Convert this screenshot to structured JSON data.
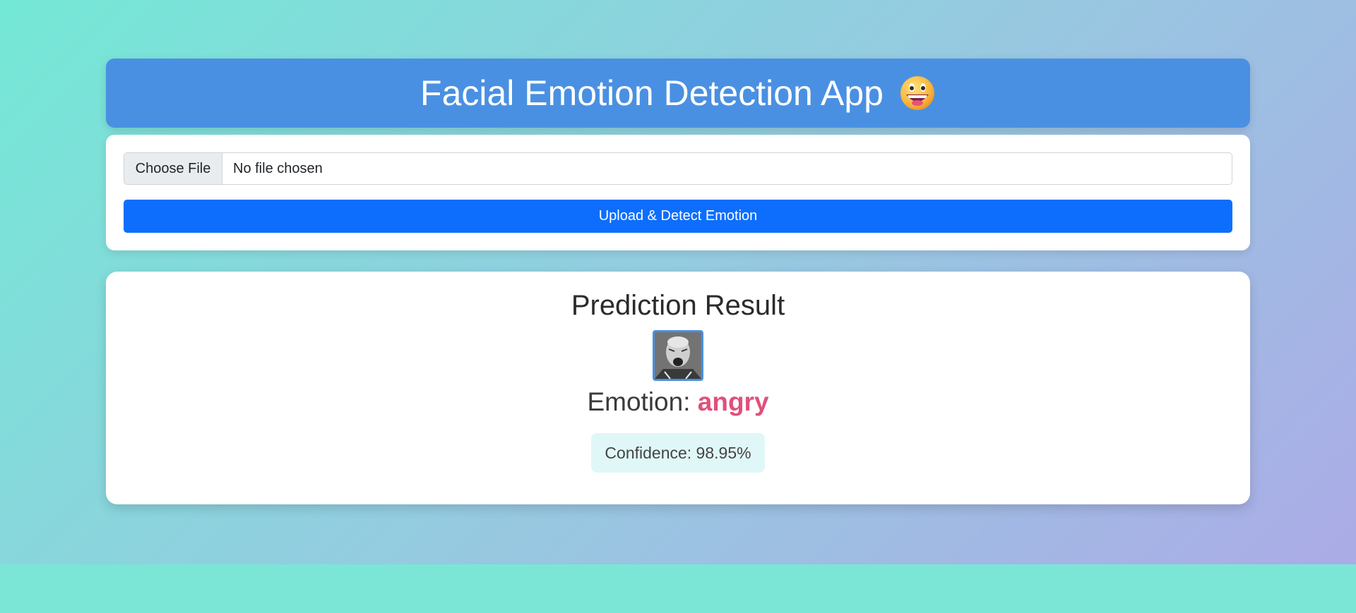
{
  "header": {
    "title": "Facial Emotion Detection App",
    "emoji_icon": "grinning-face-icon"
  },
  "upload": {
    "choose_label": "Choose File",
    "file_status": "No file chosen",
    "submit_label": "Upload & Detect Emotion"
  },
  "result": {
    "title": "Prediction Result",
    "image_icon": "uploaded-face-thumbnail",
    "emotion_label": "Emotion:",
    "emotion_value": "angry",
    "confidence_text": "Confidence: 98.95%"
  },
  "colors": {
    "header_bg": "#4a90e2",
    "primary_button": "#0d6efd",
    "emotion_accent": "#e0507a",
    "confidence_bg": "#e0f7f8",
    "gradient_start": "#74e8d6",
    "gradient_end": "#ababe6"
  }
}
